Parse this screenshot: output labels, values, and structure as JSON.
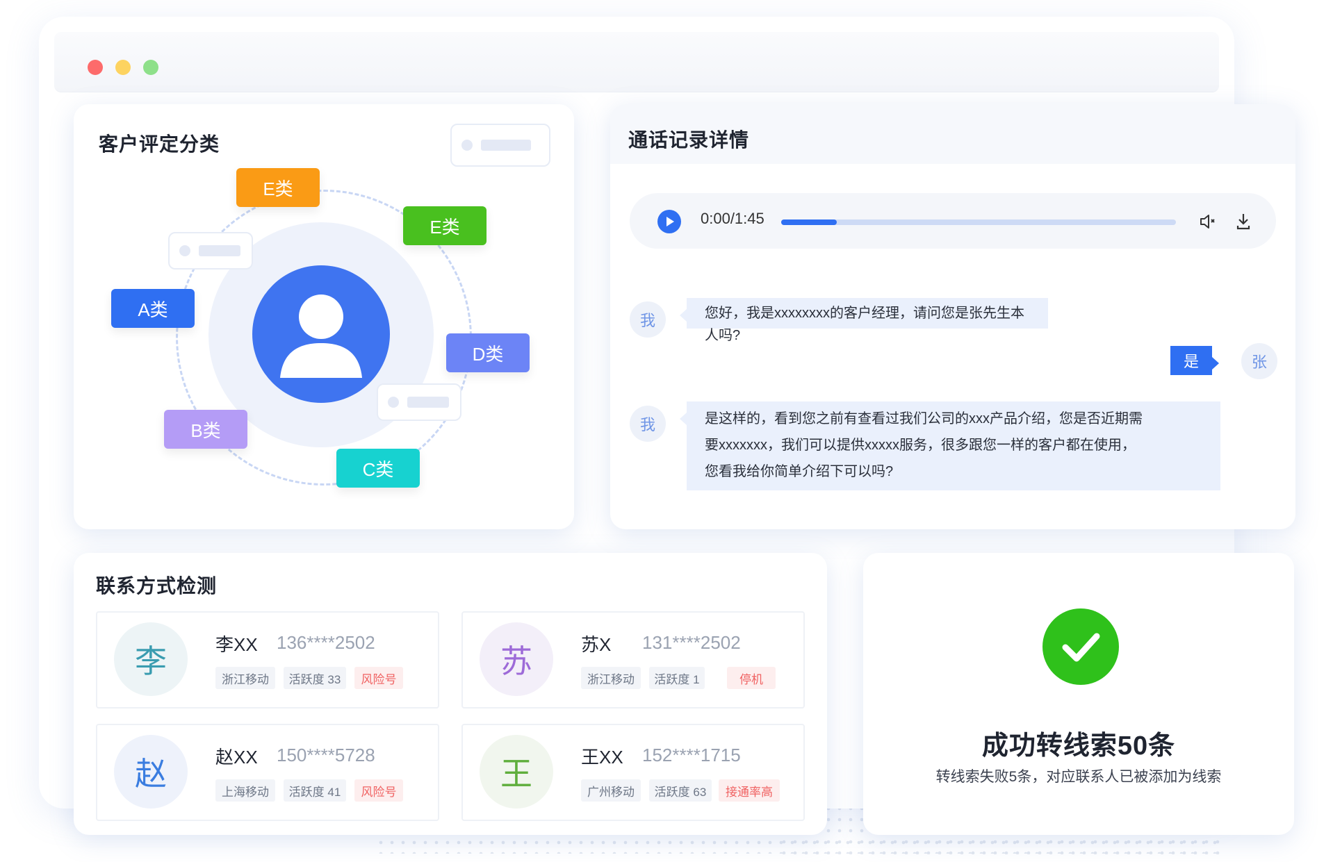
{
  "classify": {
    "title": "客户评定分类",
    "tags": [
      {
        "label": "E类",
        "color": "#fa9b15"
      },
      {
        "label": "E类",
        "color": "#49c01f"
      },
      {
        "label": "A类",
        "color": "#2f6ff2"
      },
      {
        "label": "D类",
        "color": "#6c84f6"
      },
      {
        "label": "B类",
        "color": "#b49cf6"
      },
      {
        "label": "C类",
        "color": "#17d2d0"
      }
    ]
  },
  "call": {
    "title": "通话记录详情",
    "player": {
      "time": "0:00/1:45",
      "progress": 0.14
    },
    "messages": [
      {
        "avatar": "我",
        "text": "您好，我是xxxxxxxx的客户经理，请问您是张先生本人吗?"
      },
      {
        "avatar": "张",
        "text": "是"
      },
      {
        "avatar": "我",
        "lines": [
          "是这样的，看到您之前有查看过我们公司的xxx产品介绍，您是否近期需",
          "要xxxxxxx，我们可以提供xxxxx服务，很多跟您一样的客户都在使用，",
          "您看我给你简单介绍下可以吗?"
        ]
      }
    ]
  },
  "contact": {
    "title": "联系方式检测",
    "people": [
      {
        "surname": "李",
        "name": "李XX",
        "phone": "136****2502",
        "carrier": "浙江移动",
        "activity": "活跃度 33",
        "flag": "风险号",
        "avatar_color": "#3a9cb0",
        "avatar_bg": "#edf4f6"
      },
      {
        "surname": "苏",
        "name": "苏X",
        "phone": "131****2502",
        "carrier": "浙江移动",
        "activity": "活跃度 1",
        "flag": "停机",
        "avatar_color": "#9d6ad8",
        "avatar_bg": "#f3eff9"
      },
      {
        "surname": "赵",
        "name": "赵XX",
        "phone": "150****5728",
        "carrier": "上海移动",
        "activity": "活跃度 41",
        "flag": "风险号",
        "avatar_color": "#3a7de0",
        "avatar_bg": "#eef2fb"
      },
      {
        "surname": "王",
        "name": "王XX",
        "phone": "152****1715",
        "carrier": "广州移动",
        "activity": "活跃度 63",
        "flag": "接通率高",
        "avatar_color": "#5fae3c",
        "avatar_bg": "#f1f6ee"
      }
    ]
  },
  "result": {
    "title": "成功转线索50条",
    "subtitle": "转线索失败5条，对应联系人已被添加为线索",
    "accent": "#2fc11b"
  }
}
